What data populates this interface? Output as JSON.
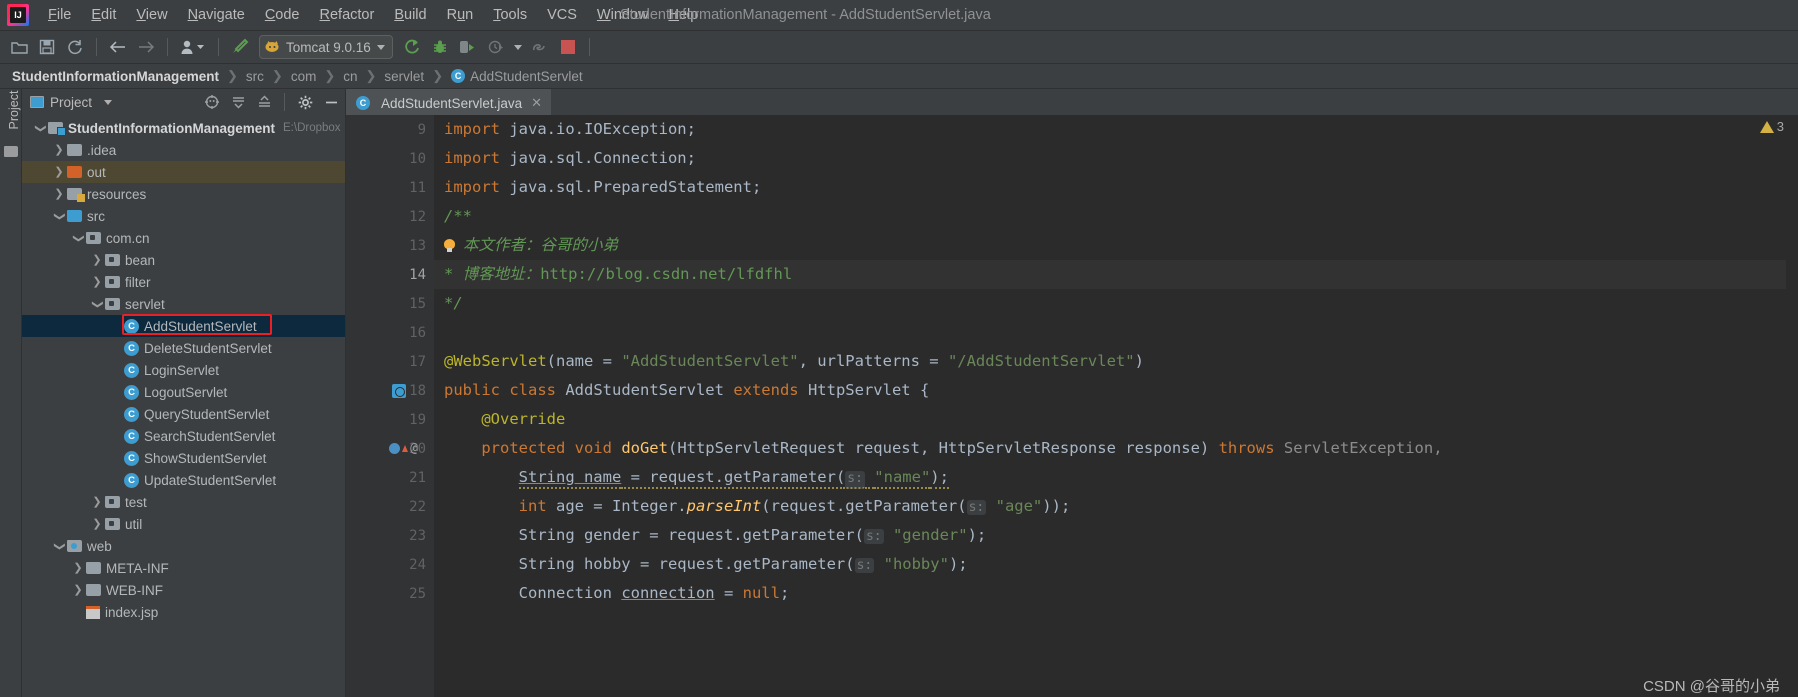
{
  "window": {
    "title": "StudentInformationManagement - AddStudentServlet.java",
    "logo_icon": "intellij-idea-logo"
  },
  "menu": {
    "items": [
      {
        "label": "File",
        "mnemonic": "F"
      },
      {
        "label": "Edit",
        "mnemonic": "E"
      },
      {
        "label": "View",
        "mnemonic": "V"
      },
      {
        "label": "Navigate",
        "mnemonic": "N"
      },
      {
        "label": "Code",
        "mnemonic": "C"
      },
      {
        "label": "Refactor",
        "mnemonic": "R"
      },
      {
        "label": "Build",
        "mnemonic": "B"
      },
      {
        "label": "Run",
        "mnemonic": "u"
      },
      {
        "label": "Tools",
        "mnemonic": "T"
      },
      {
        "label": "VCS",
        "mnemonic": ""
      },
      {
        "label": "Window",
        "mnemonic": "W"
      },
      {
        "label": "Help",
        "mnemonic": "H"
      }
    ]
  },
  "toolbar": {
    "open_icon": "open-folder-icon",
    "save_icon": "save-icon",
    "sync_icon": "refresh-icon",
    "back_icon": "arrow-left-icon",
    "forward_icon": "arrow-right-icon",
    "profile_icon": "user-profile-icon",
    "build_icon": "hammer-build-icon",
    "run_config_label": "Tomcat 9.0.16",
    "run_config_icon": "tomcat-cat-icon",
    "run_icon": "run-green-arrow-icon",
    "debug_icon": "debug-bug-icon",
    "run_coverage_icon": "run-with-coverage-icon",
    "profiler_icon": "profiler-clock-icon",
    "attach_icon": "attach-debugger-icon",
    "stop_icon": "stop-square-icon",
    "stop_color": "#c75450"
  },
  "breadcrumb": {
    "segments": [
      "StudentInformationManagement",
      "src",
      "com",
      "cn",
      "servlet",
      "AddStudentServlet"
    ],
    "class_badge": "C",
    "separator": "❯"
  },
  "left_strip": {
    "vertical_tab": "Project",
    "structure_icon": "folder-icon"
  },
  "project_panel": {
    "title": "Project",
    "title_icon": "project-view-icon",
    "dropdown_icon": "chevron-down-icon",
    "actions": [
      {
        "name": "locate-icon",
        "glyph": "⊕"
      },
      {
        "name": "expand-all-icon",
        "glyph": "≡"
      },
      {
        "name": "collapse-all-icon",
        "glyph": "≡"
      },
      {
        "name": "settings-gear-icon",
        "glyph": "⚙"
      },
      {
        "name": "hide-panel-icon",
        "glyph": "−"
      }
    ],
    "tree": [
      {
        "label": "StudentInformationManagement",
        "sub": "E:\\Dropbox",
        "indent": 0,
        "twist": "v",
        "icon": "module-folder",
        "bold": true
      },
      {
        "label": ".idea",
        "sub": "",
        "indent": 1,
        "twist": ">",
        "icon": "folder-grey"
      },
      {
        "label": "out",
        "sub": "",
        "indent": 1,
        "twist": ">",
        "icon": "folder-orange",
        "state": "highlight"
      },
      {
        "label": "resources",
        "sub": "",
        "indent": 1,
        "twist": ">",
        "icon": "folder-resources"
      },
      {
        "label": "src",
        "sub": "",
        "indent": 1,
        "twist": "v",
        "icon": "folder-source"
      },
      {
        "label": "com.cn",
        "sub": "",
        "indent": 2,
        "twist": "v",
        "icon": "package"
      },
      {
        "label": "bean",
        "sub": "",
        "indent": 3,
        "twist": ">",
        "icon": "package"
      },
      {
        "label": "filter",
        "sub": "",
        "indent": 3,
        "twist": ">",
        "icon": "package"
      },
      {
        "label": "servlet",
        "sub": "",
        "indent": 3,
        "twist": "v",
        "icon": "package"
      },
      {
        "label": "AddStudentServlet",
        "sub": "",
        "indent": 4,
        "twist": "",
        "icon": "java-class",
        "state": "selected",
        "marked": true
      },
      {
        "label": "DeleteStudentServlet",
        "sub": "",
        "indent": 4,
        "twist": "",
        "icon": "java-class"
      },
      {
        "label": "LoginServlet",
        "sub": "",
        "indent": 4,
        "twist": "",
        "icon": "java-class"
      },
      {
        "label": "LogoutServlet",
        "sub": "",
        "indent": 4,
        "twist": "",
        "icon": "java-class"
      },
      {
        "label": "QueryStudentServlet",
        "sub": "",
        "indent": 4,
        "twist": "",
        "icon": "java-class"
      },
      {
        "label": "SearchStudentServlet",
        "sub": "",
        "indent": 4,
        "twist": "",
        "icon": "java-class"
      },
      {
        "label": "ShowStudentServlet",
        "sub": "",
        "indent": 4,
        "twist": "",
        "icon": "java-class"
      },
      {
        "label": "UpdateStudentServlet",
        "sub": "",
        "indent": 4,
        "twist": "",
        "icon": "java-class"
      },
      {
        "label": "test",
        "sub": "",
        "indent": 3,
        "twist": ">",
        "icon": "package"
      },
      {
        "label": "util",
        "sub": "",
        "indent": 3,
        "twist": ">",
        "icon": "package"
      },
      {
        "label": "web",
        "sub": "",
        "indent": 1,
        "twist": "v",
        "icon": "folder-web"
      },
      {
        "label": "META-INF",
        "sub": "",
        "indent": 2,
        "twist": ">",
        "icon": "folder-grey"
      },
      {
        "label": "WEB-INF",
        "sub": "",
        "indent": 2,
        "twist": ">",
        "icon": "folder-grey"
      },
      {
        "label": "index.jsp",
        "sub": "",
        "indent": 2,
        "twist": "",
        "icon": "jsp-file"
      }
    ]
  },
  "editor": {
    "tab": {
      "label": "AddStudentServlet.java",
      "badge": "C",
      "close_icon": "close-icon"
    },
    "inspection": {
      "count": "3",
      "icon": "warning-triangle-icon"
    },
    "lines": [
      {
        "n": "9",
        "frag": [
          {
            "t": "import ",
            "c": "kw"
          },
          {
            "t": "java.io.IOException;",
            "c": "cls"
          }
        ],
        "indent": 0
      },
      {
        "n": "10",
        "frag": [
          {
            "t": "import ",
            "c": "kw"
          },
          {
            "t": "java.sql.Connection;",
            "c": "cls"
          }
        ],
        "indent": 0
      },
      {
        "n": "11",
        "frag": [
          {
            "t": "import ",
            "c": "kw"
          },
          {
            "t": "java.sql.PreparedStatement;",
            "c": "cls"
          }
        ],
        "indent": 0,
        "fold": true
      },
      {
        "n": "12",
        "frag": [
          {
            "t": "/**",
            "c": "cmt"
          }
        ],
        "indent": 0,
        "fold": true
      },
      {
        "n": "13",
        "frag": [
          {
            "t": "本文作者：谷哥的小弟",
            "c": "cmt"
          }
        ],
        "indent": 0,
        "bulb": true
      },
      {
        "n": "14",
        "frag": [
          {
            "t": "* ",
            "c": "cmt"
          },
          {
            "t": "博客地址：",
            "c": "cmt"
          },
          {
            "t": "http://blog.csdn.net/lfdfhl",
            "c": "cmt-url"
          }
        ],
        "indent": 0,
        "current": true
      },
      {
        "n": "15",
        "frag": [
          {
            "t": "*/",
            "c": "cmt"
          }
        ],
        "indent": 0,
        "fold": true
      },
      {
        "n": "16",
        "frag": [],
        "indent": 0
      },
      {
        "n": "17",
        "frag": [
          {
            "t": "@WebServlet",
            "c": "anno"
          },
          {
            "t": "(name = ",
            "c": "cls"
          },
          {
            "t": "\"AddStudentServlet\"",
            "c": "str"
          },
          {
            "t": ", urlPatterns = ",
            "c": "cls"
          },
          {
            "t": "\"/AddStudentServlet\"",
            "c": "str"
          },
          {
            "t": ")",
            "c": "cls"
          }
        ],
        "indent": 0
      },
      {
        "n": "18",
        "frag": [
          {
            "t": "public class ",
            "c": "kw"
          },
          {
            "t": "AddStudentServlet ",
            "c": "cls"
          },
          {
            "t": "extends ",
            "c": "kw"
          },
          {
            "t": "HttpServlet {",
            "c": "cls"
          }
        ],
        "indent": 0,
        "gutter_icon": "implemented-marker"
      },
      {
        "n": "19",
        "frag": [
          {
            "t": "@Override",
            "c": "anno"
          }
        ],
        "indent": 1
      },
      {
        "n": "20",
        "frag": [
          {
            "t": "protected void ",
            "c": "kw"
          },
          {
            "t": "doGet",
            "c": "meth"
          },
          {
            "t": "(HttpServletRequest request, HttpServletResponse response) ",
            "c": "cls"
          },
          {
            "t": "throws ",
            "c": "kw"
          },
          {
            "t": "ServletException,",
            "c": "err"
          }
        ],
        "indent": 1,
        "gutter_icon": "override-marker",
        "fold": true
      },
      {
        "n": "21",
        "frag": [
          {
            "t": "String name",
            "c": "ul"
          },
          {
            "t": " = request.getParameter(",
            "c": "cls"
          },
          {
            "t": "s:",
            "c": "hint"
          },
          {
            "t": " ",
            "c": "cls"
          },
          {
            "t": "\"name\"",
            "c": "str"
          },
          {
            "t": ");",
            "c": "cls"
          }
        ],
        "indent": 2,
        "squiggly": true
      },
      {
        "n": "22",
        "frag": [
          {
            "t": "int ",
            "c": "kw"
          },
          {
            "t": "age = Integer.",
            "c": "cls"
          },
          {
            "t": "parseInt",
            "c": "methit"
          },
          {
            "t": "(request.getParameter(",
            "c": "cls"
          },
          {
            "t": "s:",
            "c": "hint"
          },
          {
            "t": " ",
            "c": "cls"
          },
          {
            "t": "\"age\"",
            "c": "str"
          },
          {
            "t": "));",
            "c": "cls"
          }
        ],
        "indent": 2
      },
      {
        "n": "23",
        "frag": [
          {
            "t": "String gender = request.getParameter(",
            "c": "cls"
          },
          {
            "t": "s:",
            "c": "hint"
          },
          {
            "t": " ",
            "c": "cls"
          },
          {
            "t": "\"gender\"",
            "c": "str"
          },
          {
            "t": ");",
            "c": "cls"
          }
        ],
        "indent": 2
      },
      {
        "n": "24",
        "frag": [
          {
            "t": "String hobby = request.getParameter(",
            "c": "cls"
          },
          {
            "t": "s:",
            "c": "hint"
          },
          {
            "t": " ",
            "c": "cls"
          },
          {
            "t": "\"hobby\"",
            "c": "str"
          },
          {
            "t": ");",
            "c": "cls"
          }
        ],
        "indent": 2
      },
      {
        "n": "25",
        "frag": [
          {
            "t": "Connection ",
            "c": "cls"
          },
          {
            "t": "connection",
            "c": "ul"
          },
          {
            "t": " = ",
            "c": "cls"
          },
          {
            "t": "null",
            "c": "kw"
          },
          {
            "t": ";",
            "c": "cls"
          }
        ],
        "indent": 2
      }
    ]
  },
  "watermark": {
    "text": "CSDN @谷哥的小弟"
  },
  "colors": {
    "background": "#3c3f41",
    "editor_background": "#2b2b2b",
    "gutter": "#313335",
    "selection": "#0d293e",
    "accent_blue": "#3d9dd1",
    "keyword_orange": "#cc7832",
    "string_green": "#6a8759",
    "comment_green": "#629755",
    "annotation_yellow": "#bbb529",
    "method_yellow": "#ffc66d",
    "mark_red": "#ec2024"
  }
}
